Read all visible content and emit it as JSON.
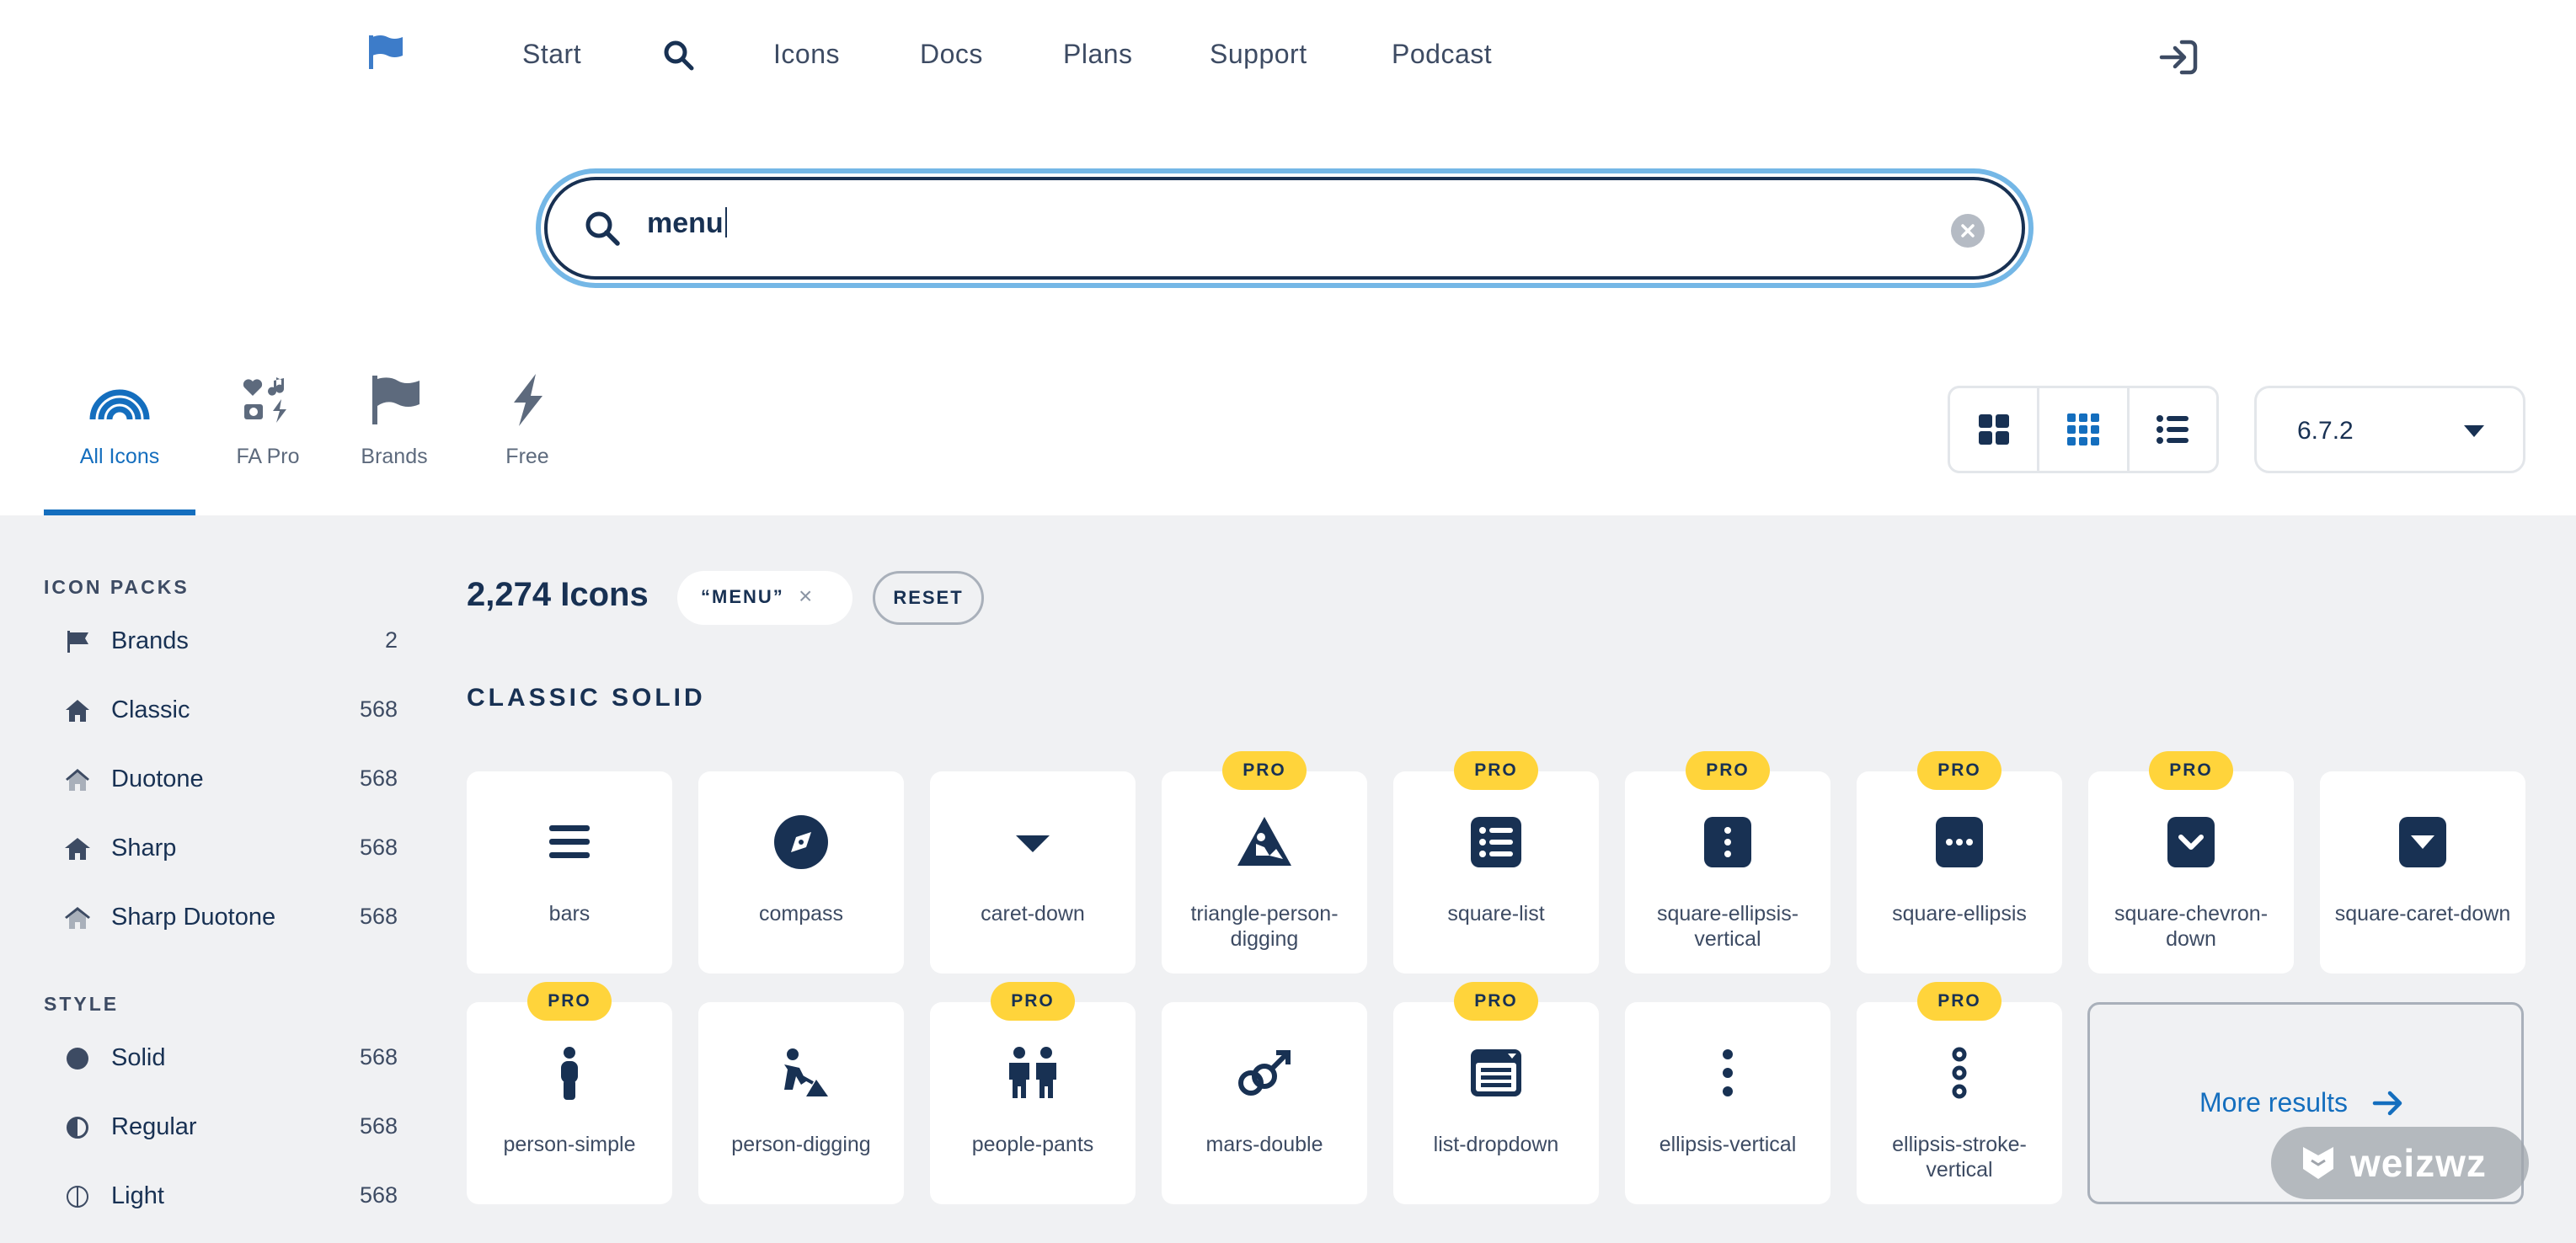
{
  "nav": {
    "links": [
      "Start",
      "Icons",
      "Docs",
      "Plans",
      "Support",
      "Podcast"
    ]
  },
  "search": {
    "value": "menu"
  },
  "families": [
    {
      "label": "All Icons",
      "active": true
    },
    {
      "label": "FA Pro",
      "active": false
    },
    {
      "label": "Brands",
      "active": false
    },
    {
      "label": "Free",
      "active": false
    }
  ],
  "version": {
    "selected": "6.7.2"
  },
  "sidebar": {
    "packs_heading": "ICON PACKS",
    "packs": [
      {
        "label": "Brands",
        "count": "2",
        "icon": "flag-icon"
      },
      {
        "label": "Classic",
        "count": "568",
        "icon": "house-icon"
      },
      {
        "label": "Duotone",
        "count": "568",
        "icon": "house-duotone-icon"
      },
      {
        "label": "Sharp",
        "count": "568",
        "icon": "house-sharp-icon"
      },
      {
        "label": "Sharp Duotone",
        "count": "568",
        "icon": "house-sharp-duotone-icon"
      }
    ],
    "style_heading": "STYLE",
    "styles": [
      {
        "label": "Solid",
        "count": "568",
        "icon": "circle-solid-icon"
      },
      {
        "label": "Regular",
        "count": "568",
        "icon": "circle-half-icon"
      },
      {
        "label": "Light",
        "count": "568",
        "icon": "circle-light-icon"
      }
    ]
  },
  "results": {
    "count_label": "2,274 Icons",
    "filter_chip": "“MENU”",
    "chip_close": "×",
    "reset_label": "RESET",
    "section_heading": "CLASSIC SOLID",
    "pro_label": "PRO",
    "more_label": "More results",
    "icons": [
      {
        "name": "bars",
        "pro": false,
        "icon": "bars-icon"
      },
      {
        "name": "compass",
        "pro": false,
        "icon": "compass-icon"
      },
      {
        "name": "caret-down",
        "pro": false,
        "icon": "caret-down-icon"
      },
      {
        "name": "triangle-person-digging",
        "pro": true,
        "icon": "triangle-person-digging-icon"
      },
      {
        "name": "square-list",
        "pro": true,
        "icon": "square-list-icon"
      },
      {
        "name": "square-ellipsis-vertical",
        "pro": true,
        "icon": "square-ellipsis-vertical-icon"
      },
      {
        "name": "square-ellipsis",
        "pro": true,
        "icon": "square-ellipsis-icon"
      },
      {
        "name": "square-chevron-down",
        "pro": true,
        "icon": "square-chevron-down-icon"
      },
      {
        "name": "square-caret-down",
        "pro": false,
        "icon": "square-caret-down-icon"
      },
      {
        "name": "person-simple",
        "pro": true,
        "icon": "person-simple-icon"
      },
      {
        "name": "person-digging",
        "pro": false,
        "icon": "person-digging-icon"
      },
      {
        "name": "people-pants",
        "pro": true,
        "icon": "people-pants-icon"
      },
      {
        "name": "mars-double",
        "pro": false,
        "icon": "mars-double-icon"
      },
      {
        "name": "list-dropdown",
        "pro": true,
        "icon": "list-dropdown-icon"
      },
      {
        "name": "ellipsis-vertical",
        "pro": false,
        "icon": "ellipsis-vertical-icon"
      },
      {
        "name": "ellipsis-stroke-vertical",
        "pro": true,
        "icon": "ellipsis-stroke-vertical-icon"
      }
    ]
  },
  "watermark": "weizwz",
  "colors": {
    "navy": "#183153",
    "accent_blue": "#146ebe",
    "focus_ring": "#74b7e6",
    "pro_yellow": "#ffd43b",
    "panel_bg": "#f0f1f3"
  }
}
